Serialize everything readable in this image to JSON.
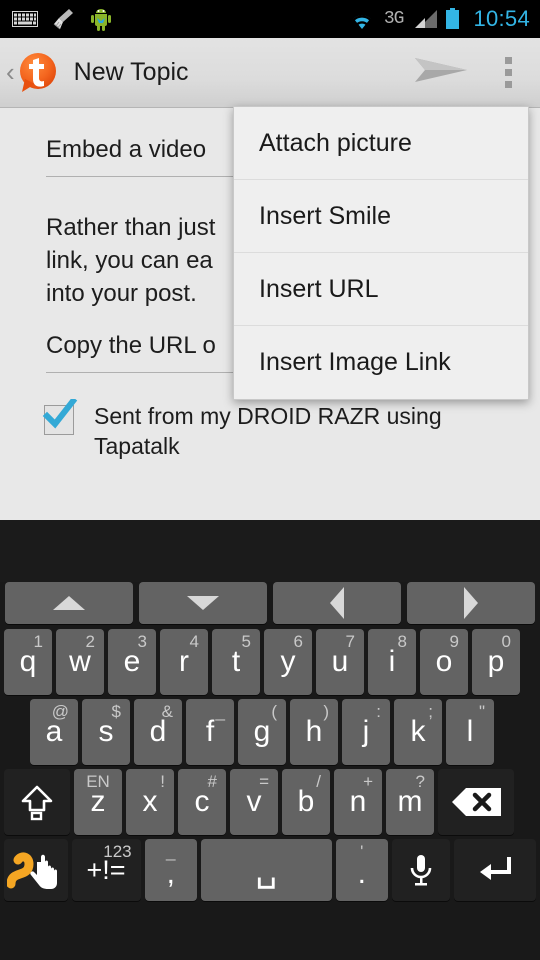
{
  "statusbar": {
    "icons_left": [
      "keyboard-icon",
      "broom-icon",
      "android-robot-icon"
    ],
    "icons_right": [
      "wifi-icon",
      "network-3g-icon",
      "signal-bars-icon",
      "battery-icon"
    ],
    "network_label": "3G",
    "time": "10:54",
    "accent_color": "#33b5e5"
  },
  "actionbar": {
    "back_label": "‹",
    "app_icon": "tapatalk-logo-icon",
    "title": "New Topic",
    "send_icon": "send-arrow-icon",
    "overflow_icon": "overflow-menu-icon",
    "logo_color": "#f26522"
  },
  "form": {
    "subject_value": "Embed a video",
    "body_value": "Rather than just\nlink, you can ea\ninto your post.",
    "url_value": "Copy the URL o",
    "signature_label": "Sent from my DROID RAZR using Tapatalk",
    "signature_checked": true,
    "check_color": "#33a9d6"
  },
  "menu": {
    "items": [
      {
        "label": "Attach picture"
      },
      {
        "label": "Insert Smile"
      },
      {
        "label": "Insert URL"
      },
      {
        "label": "Insert Image Link"
      }
    ]
  },
  "keyboard": {
    "nav": [
      {
        "name": "arrow-up-key",
        "dir": "up"
      },
      {
        "name": "arrow-down-key",
        "dir": "dn"
      },
      {
        "name": "arrow-left-key",
        "dir": "lf"
      },
      {
        "name": "arrow-right-key",
        "dir": "rt"
      }
    ],
    "row1": [
      {
        "main": "q",
        "sup": "1"
      },
      {
        "main": "w",
        "sup": "2"
      },
      {
        "main": "e",
        "sup": "3"
      },
      {
        "main": "r",
        "sup": "4"
      },
      {
        "main": "t",
        "sup": "5"
      },
      {
        "main": "y",
        "sup": "6"
      },
      {
        "main": "u",
        "sup": "7"
      },
      {
        "main": "i",
        "sup": "8"
      },
      {
        "main": "o",
        "sup": "9"
      },
      {
        "main": "p",
        "sup": "0"
      }
    ],
    "row2": [
      {
        "main": "a",
        "sup": "@"
      },
      {
        "main": "s",
        "sup": "$"
      },
      {
        "main": "d",
        "sup": "&"
      },
      {
        "main": "f",
        "sup": "_"
      },
      {
        "main": "g",
        "sup": "("
      },
      {
        "main": "h",
        "sup": ")"
      },
      {
        "main": "j",
        "sup": ":"
      },
      {
        "main": "k",
        "sup": ";"
      },
      {
        "main": "l",
        "sup": "\""
      }
    ],
    "row3": [
      {
        "main": "z",
        "sup": "EN"
      },
      {
        "main": "x",
        "sup": "!"
      },
      {
        "main": "c",
        "sup": "#"
      },
      {
        "main": "v",
        "sup": "="
      },
      {
        "main": "b",
        "sup": "/"
      },
      {
        "main": "n",
        "sup": "+"
      },
      {
        "main": "m",
        "sup": "?"
      }
    ],
    "shift_key": "shift-key",
    "backspace_key": "backspace-key",
    "row4": {
      "swype_key": "swype-gesture-key",
      "symbols_sup": "123",
      "symbols_main": "+!=",
      "comma_sup": "_",
      "comma_main": ",",
      "space_main": "␣",
      "period_sup": "'",
      "period_main": ".",
      "mic_key": "microphone-key",
      "enter_key": "enter-key"
    },
    "swype_color": "#f5a623"
  }
}
